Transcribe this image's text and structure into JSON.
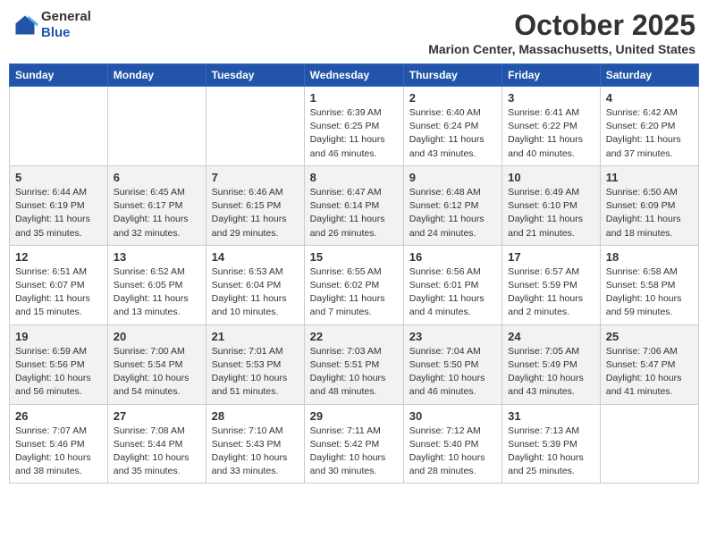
{
  "logo": {
    "general": "General",
    "blue": "Blue"
  },
  "title": "October 2025",
  "location": "Marion Center, Massachusetts, United States",
  "weekdays": [
    "Sunday",
    "Monday",
    "Tuesday",
    "Wednesday",
    "Thursday",
    "Friday",
    "Saturday"
  ],
  "weeks": [
    [
      {
        "day": "",
        "info": ""
      },
      {
        "day": "",
        "info": ""
      },
      {
        "day": "",
        "info": ""
      },
      {
        "day": "1",
        "info": "Sunrise: 6:39 AM\nSunset: 6:25 PM\nDaylight: 11 hours\nand 46 minutes."
      },
      {
        "day": "2",
        "info": "Sunrise: 6:40 AM\nSunset: 6:24 PM\nDaylight: 11 hours\nand 43 minutes."
      },
      {
        "day": "3",
        "info": "Sunrise: 6:41 AM\nSunset: 6:22 PM\nDaylight: 11 hours\nand 40 minutes."
      },
      {
        "day": "4",
        "info": "Sunrise: 6:42 AM\nSunset: 6:20 PM\nDaylight: 11 hours\nand 37 minutes."
      }
    ],
    [
      {
        "day": "5",
        "info": "Sunrise: 6:44 AM\nSunset: 6:19 PM\nDaylight: 11 hours\nand 35 minutes."
      },
      {
        "day": "6",
        "info": "Sunrise: 6:45 AM\nSunset: 6:17 PM\nDaylight: 11 hours\nand 32 minutes."
      },
      {
        "day": "7",
        "info": "Sunrise: 6:46 AM\nSunset: 6:15 PM\nDaylight: 11 hours\nand 29 minutes."
      },
      {
        "day": "8",
        "info": "Sunrise: 6:47 AM\nSunset: 6:14 PM\nDaylight: 11 hours\nand 26 minutes."
      },
      {
        "day": "9",
        "info": "Sunrise: 6:48 AM\nSunset: 6:12 PM\nDaylight: 11 hours\nand 24 minutes."
      },
      {
        "day": "10",
        "info": "Sunrise: 6:49 AM\nSunset: 6:10 PM\nDaylight: 11 hours\nand 21 minutes."
      },
      {
        "day": "11",
        "info": "Sunrise: 6:50 AM\nSunset: 6:09 PM\nDaylight: 11 hours\nand 18 minutes."
      }
    ],
    [
      {
        "day": "12",
        "info": "Sunrise: 6:51 AM\nSunset: 6:07 PM\nDaylight: 11 hours\nand 15 minutes."
      },
      {
        "day": "13",
        "info": "Sunrise: 6:52 AM\nSunset: 6:05 PM\nDaylight: 11 hours\nand 13 minutes."
      },
      {
        "day": "14",
        "info": "Sunrise: 6:53 AM\nSunset: 6:04 PM\nDaylight: 11 hours\nand 10 minutes."
      },
      {
        "day": "15",
        "info": "Sunrise: 6:55 AM\nSunset: 6:02 PM\nDaylight: 11 hours\nand 7 minutes."
      },
      {
        "day": "16",
        "info": "Sunrise: 6:56 AM\nSunset: 6:01 PM\nDaylight: 11 hours\nand 4 minutes."
      },
      {
        "day": "17",
        "info": "Sunrise: 6:57 AM\nSunset: 5:59 PM\nDaylight: 11 hours\nand 2 minutes."
      },
      {
        "day": "18",
        "info": "Sunrise: 6:58 AM\nSunset: 5:58 PM\nDaylight: 10 hours\nand 59 minutes."
      }
    ],
    [
      {
        "day": "19",
        "info": "Sunrise: 6:59 AM\nSunset: 5:56 PM\nDaylight: 10 hours\nand 56 minutes."
      },
      {
        "day": "20",
        "info": "Sunrise: 7:00 AM\nSunset: 5:54 PM\nDaylight: 10 hours\nand 54 minutes."
      },
      {
        "day": "21",
        "info": "Sunrise: 7:01 AM\nSunset: 5:53 PM\nDaylight: 10 hours\nand 51 minutes."
      },
      {
        "day": "22",
        "info": "Sunrise: 7:03 AM\nSunset: 5:51 PM\nDaylight: 10 hours\nand 48 minutes."
      },
      {
        "day": "23",
        "info": "Sunrise: 7:04 AM\nSunset: 5:50 PM\nDaylight: 10 hours\nand 46 minutes."
      },
      {
        "day": "24",
        "info": "Sunrise: 7:05 AM\nSunset: 5:49 PM\nDaylight: 10 hours\nand 43 minutes."
      },
      {
        "day": "25",
        "info": "Sunrise: 7:06 AM\nSunset: 5:47 PM\nDaylight: 10 hours\nand 41 minutes."
      }
    ],
    [
      {
        "day": "26",
        "info": "Sunrise: 7:07 AM\nSunset: 5:46 PM\nDaylight: 10 hours\nand 38 minutes."
      },
      {
        "day": "27",
        "info": "Sunrise: 7:08 AM\nSunset: 5:44 PM\nDaylight: 10 hours\nand 35 minutes."
      },
      {
        "day": "28",
        "info": "Sunrise: 7:10 AM\nSunset: 5:43 PM\nDaylight: 10 hours\nand 33 minutes."
      },
      {
        "day": "29",
        "info": "Sunrise: 7:11 AM\nSunset: 5:42 PM\nDaylight: 10 hours\nand 30 minutes."
      },
      {
        "day": "30",
        "info": "Sunrise: 7:12 AM\nSunset: 5:40 PM\nDaylight: 10 hours\nand 28 minutes."
      },
      {
        "day": "31",
        "info": "Sunrise: 7:13 AM\nSunset: 5:39 PM\nDaylight: 10 hours\nand 25 minutes."
      },
      {
        "day": "",
        "info": ""
      }
    ]
  ]
}
